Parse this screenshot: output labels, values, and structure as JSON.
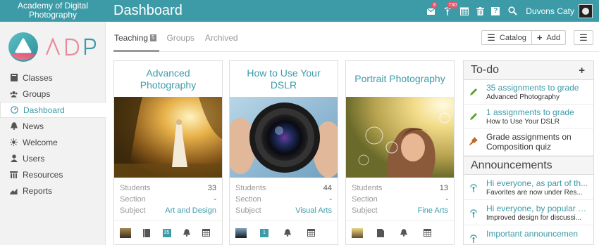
{
  "app": {
    "school_line1": "Academy of Digital",
    "school_line2": "Photography",
    "page_title": "Dashboard",
    "brand_color": "#3d9ba8"
  },
  "topbar": {
    "icons": [
      "inbox-icon",
      "notifications-icon",
      "calendar-icon",
      "trash-icon",
      "help-icon",
      "search-icon"
    ],
    "inbox_badge": "3",
    "notifications_badge": "730",
    "help_glyph": "?",
    "user_name": "Duvons Caty"
  },
  "sidebar": {
    "logo_text": "ADP",
    "items": [
      {
        "label": "Classes",
        "icon": "book-icon"
      },
      {
        "label": "Groups",
        "icon": "users-icon"
      },
      {
        "label": "Dashboard",
        "icon": "dashboard-icon",
        "active": true
      },
      {
        "label": "News",
        "icon": "bell-icon"
      },
      {
        "label": "Welcome",
        "icon": "sun-icon"
      },
      {
        "label": "Users",
        "icon": "user-icon"
      },
      {
        "label": "Resources",
        "icon": "library-icon"
      },
      {
        "label": "Reports",
        "icon": "chart-icon"
      }
    ]
  },
  "tabs": [
    {
      "label": "Teaching",
      "count": "5",
      "active": true
    },
    {
      "label": "Groups"
    },
    {
      "label": "Archived"
    }
  ],
  "toolbar": {
    "catalog_label": "Catalog",
    "add_label": "Add",
    "menu_glyph": "☰"
  },
  "labels": {
    "students": "Students",
    "section": "Section",
    "subject": "Subject"
  },
  "cards": [
    {
      "title": "Advanced Photography",
      "students": "33",
      "section": "-",
      "subject": "Art and Design",
      "icon_count": "35"
    },
    {
      "title": "How to Use Your DSLR",
      "students": "44",
      "section": "-",
      "subject": "Visual Arts",
      "icon_count": "1"
    },
    {
      "title": "Portrait Photography",
      "students": "13",
      "section": "-",
      "subject": "Fine Arts"
    }
  ],
  "todo": {
    "title": "To-do",
    "add_glyph": "+",
    "items": [
      {
        "link": "35 assignments to grade",
        "sub": "Advanced Photography",
        "icon": "pencil-icon"
      },
      {
        "link": "1 assignments to grade",
        "sub": "How to Use Your DSLR",
        "icon": "pencil-icon"
      },
      {
        "text": "Grade assignments on Composition quiz",
        "icon": "pin-icon"
      }
    ]
  },
  "announcements": {
    "title": "Announcements",
    "items": [
      {
        "link": "Hi everyone, as part of th...",
        "sub": "Favorites are now under Res...",
        "icon": "broadcast-icon"
      },
      {
        "link": "Hi everyone, by popular re...",
        "sub": "Improved design for discussi...",
        "icon": "broadcast-icon"
      },
      {
        "link": "Important announcemen",
        "icon": "broadcast-icon"
      }
    ]
  }
}
